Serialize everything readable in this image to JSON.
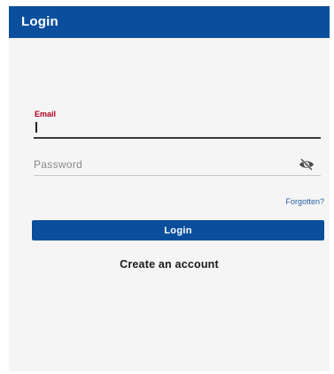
{
  "app_bar": {
    "title": "Login",
    "color": "#0b4f9c"
  },
  "form": {
    "email": {
      "label": "Email",
      "value": "",
      "label_color": "#b00020",
      "focused": true
    },
    "password": {
      "placeholder": "Password",
      "value": "",
      "toggle_icon": "eye-off-icon"
    },
    "forgotten_label": "Forgotten?",
    "login_button_label": "Login",
    "create_account_label": "Create an account"
  },
  "colors": {
    "primary": "#0b4f9c",
    "background": "#f5f5f5",
    "link": "#2a5fa8"
  }
}
